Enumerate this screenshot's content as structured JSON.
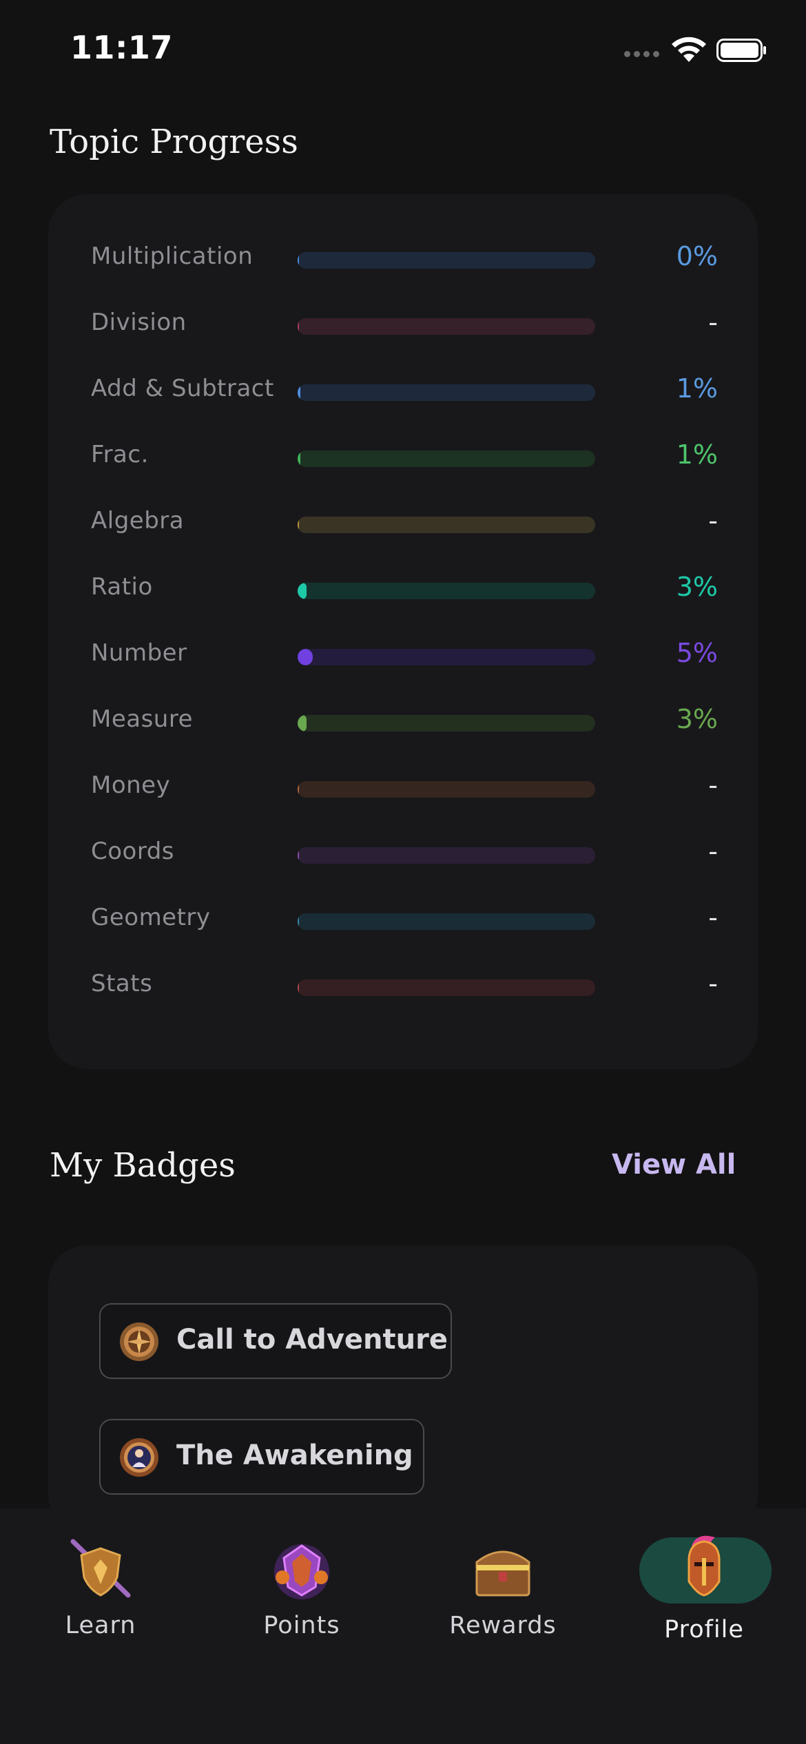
{
  "status_bar": {
    "time": "11:17"
  },
  "topic_progress": {
    "title": "Topic Progress",
    "items": [
      {
        "label": "Multiplication",
        "percent_text": "0%",
        "progress": 0.0,
        "text_color": "#5a9ae0",
        "track_color": "#1e2a3c",
        "fill_color": "#4f8fe0"
      },
      {
        "label": "Division",
        "percent_text": "-",
        "progress": 0.0,
        "text_color": "#e4e4e8",
        "track_color": "#36202a",
        "fill_color": "#b04060"
      },
      {
        "label": "Add & Subtract",
        "percent_text": "1%",
        "progress": 0.01,
        "text_color": "#5a9ae0",
        "track_color": "#1e2a3c",
        "fill_color": "#4f8fe0"
      },
      {
        "label": "Frac.",
        "percent_text": "1%",
        "progress": 0.01,
        "text_color": "#4ec46a",
        "track_color": "#1c3222",
        "fill_color": "#3fb35a"
      },
      {
        "label": "Algebra",
        "percent_text": "-",
        "progress": 0.0,
        "text_color": "#e4e4e8",
        "track_color": "#3a3424",
        "fill_color": "#c09a3a"
      },
      {
        "label": "Ratio",
        "percent_text": "3%",
        "progress": 0.03,
        "text_color": "#1ec9a8",
        "track_color": "#15332e",
        "fill_color": "#1ec9a8"
      },
      {
        "label": "Number",
        "percent_text": "5%",
        "progress": 0.05,
        "text_color": "#7b4be0",
        "track_color": "#241c3c",
        "fill_color": "#7040e0"
      },
      {
        "label": "Measure",
        "percent_text": "3%",
        "progress": 0.03,
        "text_color": "#6aa84f",
        "track_color": "#24301f",
        "fill_color": "#6aa84f"
      },
      {
        "label": "Money",
        "percent_text": "-",
        "progress": 0.0,
        "text_color": "#e4e4e8",
        "track_color": "#35261f",
        "fill_color": "#b06a40"
      },
      {
        "label": "Coords",
        "percent_text": "-",
        "progress": 0.0,
        "text_color": "#e4e4e8",
        "track_color": "#2a1f34",
        "fill_color": "#8a50b0"
      },
      {
        "label": "Geometry",
        "percent_text": "-",
        "progress": 0.0,
        "text_color": "#e4e4e8",
        "track_color": "#1a2d36",
        "fill_color": "#3a8ab0"
      },
      {
        "label": "Stats",
        "percent_text": "-",
        "progress": 0.0,
        "text_color": "#e4e4e8",
        "track_color": "#361f22",
        "fill_color": "#b04a50"
      }
    ]
  },
  "badges": {
    "title": "My Badges",
    "view_all_label": "View All",
    "items": [
      {
        "label": "Call to Adventure",
        "icon": "compass-medallion-icon"
      },
      {
        "label": "The Awakening",
        "icon": "portrait-medallion-icon"
      }
    ]
  },
  "tab_bar": {
    "tabs": [
      {
        "label": "Learn",
        "icon": "shield-sword-icon",
        "active": false
      },
      {
        "label": "Points",
        "icon": "gem-icon",
        "active": false
      },
      {
        "label": "Rewards",
        "icon": "treasure-chest-icon",
        "active": false
      },
      {
        "label": "Profile",
        "icon": "knight-helmet-icon",
        "active": true
      }
    ],
    "active_highlight_color": "#1a4a40"
  }
}
